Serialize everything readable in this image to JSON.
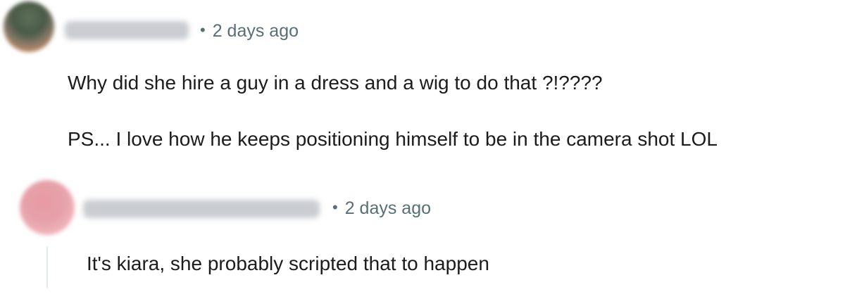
{
  "comments": [
    {
      "author": "",
      "meta_separator": "•",
      "timestamp": "2 days ago",
      "body_lines": [
        "Why did she hire a guy in a dress and a wig to do that ?!????",
        "PS... I love how he keeps positioning himself to be in the camera shot LOL"
      ]
    },
    {
      "author": "",
      "meta_separator": "•",
      "timestamp": "2 days ago",
      "body_lines": [
        "It's kiara, she probably scripted that to happen"
      ]
    }
  ],
  "colors": {
    "text": "#1c1c1c",
    "meta": "#576f76",
    "thread_line": "#e5ebee",
    "avatar_1": "#5d6f58",
    "avatar_2": "#e89aa3"
  },
  "icons": [
    "avatar",
    "avatar"
  ]
}
